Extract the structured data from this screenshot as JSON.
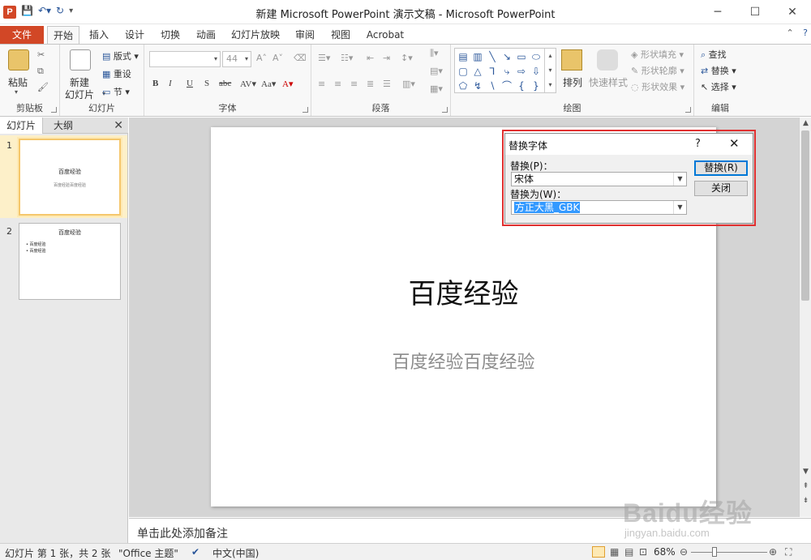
{
  "window": {
    "title": "新建 Microsoft PowerPoint 演示文稿 - Microsoft PowerPoint",
    "app_icon": "P",
    "controls": [
      "─",
      "☐",
      "✕"
    ]
  },
  "tabs": {
    "file": "文件",
    "items": [
      "开始",
      "插入",
      "设计",
      "切换",
      "动画",
      "幻灯片放映",
      "审阅",
      "视图",
      "Acrobat"
    ],
    "active": "开始"
  },
  "ribbon": {
    "clipboard": {
      "label": "剪贴板",
      "paste": "粘贴"
    },
    "slides": {
      "label": "幻灯片",
      "new_slide_1": "新建",
      "new_slide_2": "幻灯片",
      "layout": "版式",
      "reset": "重设",
      "section": "节"
    },
    "font": {
      "label": "字体",
      "size": "44"
    },
    "paragraph": {
      "label": "段落"
    },
    "drawing": {
      "label": "绘图",
      "arrange": "排列",
      "quick_styles": "快速样式",
      "shape_fill": "形状填充",
      "shape_outline": "形状轮廓",
      "shape_effects": "形状效果"
    },
    "editing": {
      "label": "编辑",
      "find": "查找",
      "replace": "替换",
      "select": "选择"
    }
  },
  "left_panel": {
    "tab_slides": "幻灯片",
    "tab_outline": "大纲",
    "slides": [
      {
        "num": "1",
        "title": "百度经验",
        "subtitle": "百度经验百度经验"
      },
      {
        "num": "2",
        "title": "百度经验",
        "bullets": [
          "百度经验",
          "百度经验"
        ]
      }
    ]
  },
  "slide": {
    "title": "百度经验",
    "subtitle": "百度经验百度经验"
  },
  "notes": {
    "placeholder": "单击此处添加备注"
  },
  "status": {
    "slide_info": "幻灯片 第 1 张，共 2 张",
    "theme": "\"Office 主题\"",
    "language": "中文(中国)",
    "zoom": "68%"
  },
  "dialog": {
    "title": "替换字体",
    "help": "?",
    "close": "✕",
    "replace_label": "替换(P)：",
    "replace_value": "宋体",
    "with_label": "替换为(W)：",
    "with_value": "方正大黑_GBK",
    "replace_button": "替换(R)",
    "close_button": "关闭"
  },
  "watermark": {
    "main": "Baidu经验",
    "sub": "jingyan.baidu.com"
  }
}
